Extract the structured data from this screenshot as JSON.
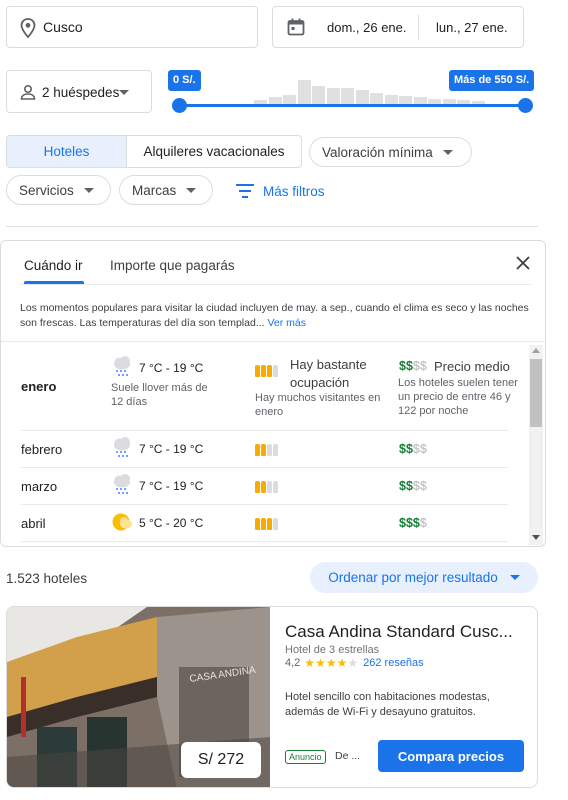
{
  "search": {
    "location": "Cusco",
    "checkin": "dom., 26 ene.",
    "checkout": "lun., 27 ene."
  },
  "guests": {
    "label": "2 huéspedes"
  },
  "price_slider": {
    "min_label": "0 S/.",
    "max_label": "Más de 550 S/.",
    "histogram": [
      0.1,
      0.18,
      0.22,
      0.55,
      0.42,
      0.38,
      0.36,
      0.32,
      0.25,
      0.22,
      0.2,
      0.17,
      0.14,
      0.12,
      0.1,
      0.08
    ]
  },
  "filters": {
    "type_tabs": [
      "Hoteles",
      "Alquileres vacacionales"
    ],
    "rating": "Valoración mínima",
    "services": "Servicios",
    "brands": "Marcas",
    "more": "Más filtros"
  },
  "insights": {
    "tabs": [
      "Cuándo ir",
      "Importe que pagarás"
    ],
    "intro": "Los momentos populares para visitar la ciudad incluyen de may. a sep., cuando el clima es seco y las noches son frescas. Las temperaturas del día son templad...",
    "more_link": "Ver más",
    "months": [
      {
        "month": "enero",
        "temp": "7 °C - 19 °C",
        "weather_desc": "Suele llover más de 12 días",
        "weather_icon": "rain-cloud-icon",
        "crowd_level": 3,
        "crowd_title": "Hay bastante ocupación",
        "crowd_desc": "Hay muchos visitantes en enero",
        "price_level": 2,
        "price_title": "Precio medio",
        "price_desc": "Los hoteles suelen tener un precio de entre 46 y 122 por noche"
      },
      {
        "month": "febrero",
        "temp": "7 °C - 19 °C",
        "weather_icon": "rain-cloud-icon",
        "crowd_level": 2,
        "price_level": 2
      },
      {
        "month": "marzo",
        "temp": "7 °C - 19 °C",
        "weather_icon": "rain-cloud-icon",
        "crowd_level": 2,
        "price_level": 2
      },
      {
        "month": "abril",
        "temp": "5 °C - 20 °C",
        "weather_icon": "partly-sunny-icon",
        "crowd_level": 3,
        "price_level": 3
      }
    ]
  },
  "results": {
    "count": "1.523 hoteles",
    "sort": "Ordenar por mejor resultado"
  },
  "hotel": {
    "name": "Casa Andina Standard Cusc...",
    "class": "Hotel de 3 estrellas",
    "rating": "4,2",
    "stars": 4.2,
    "reviews": "262 reseñas",
    "description": "Hotel sencillo con habitaciones modestas, además de Wi-Fi y desayuno gratuitos.",
    "price": "S/ 272",
    "ad_badge": "Anuncio",
    "ad_source": "De ...",
    "compare_button": "Compara precios",
    "sign_text": "CASA ANDINA"
  },
  "colors": {
    "accent": "#1a73e8",
    "selected_tab_bg": "#e8f0fe",
    "crowd": "#f9ab00",
    "price_green": "#188038"
  }
}
